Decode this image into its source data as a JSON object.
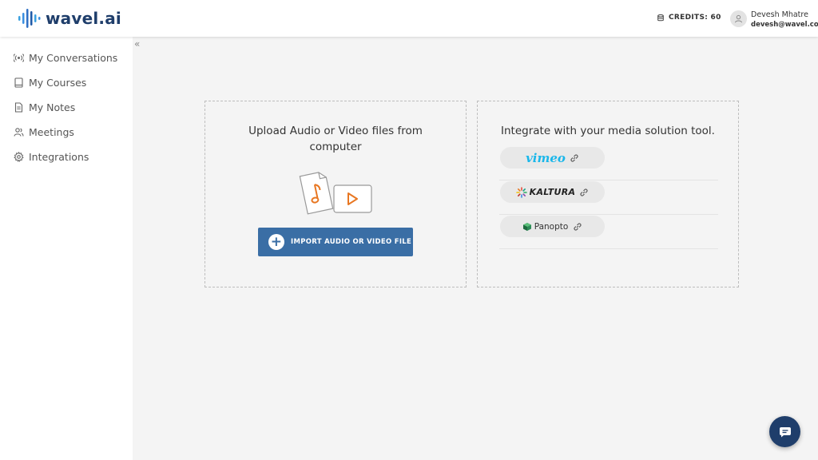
{
  "brand": {
    "name": "wavel.ai"
  },
  "header": {
    "credits_label": "CREDITS: 60",
    "user_name": "Devesh Mhatre",
    "user_email": "devesh@wavel.co"
  },
  "sidebar": {
    "collapse_glyph": "«",
    "items": [
      {
        "label": "My Conversations",
        "icon": "broadcast-icon"
      },
      {
        "label": "My Courses",
        "icon": "book-icon"
      },
      {
        "label": "My Notes",
        "icon": "document-icon"
      },
      {
        "label": "Meetings",
        "icon": "people-icon"
      },
      {
        "label": "Integrations",
        "icon": "gear-icon"
      }
    ]
  },
  "upload": {
    "title": "Upload Audio or Video files from computer",
    "button_label": "IMPORT AUDIO OR VIDEO FILE"
  },
  "integrate": {
    "title": "Integrate with your media solution tool.",
    "providers": [
      {
        "name": "vimeo"
      },
      {
        "name": "KALTURA"
      },
      {
        "name": "Panopto"
      }
    ]
  },
  "colors": {
    "accent": "#3a6ea5",
    "brand_dark": "#1f3e6b",
    "sidebar_bg": "#ffffff",
    "page_bg": "#f4f4f4"
  }
}
